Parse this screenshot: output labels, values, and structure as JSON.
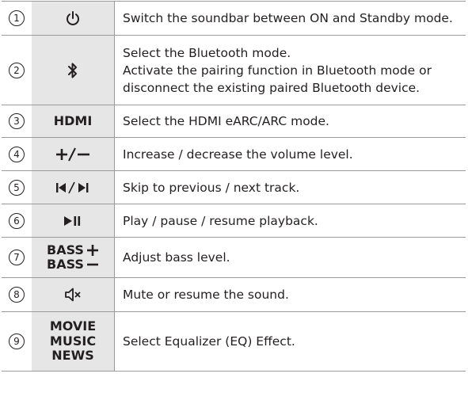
{
  "rows": [
    {
      "num": "1",
      "icon": "power-icon",
      "desc": [
        "Switch the soundbar between ON and Standby mode."
      ]
    },
    {
      "num": "2",
      "icon": "bluetooth-icon",
      "desc": [
        "Select the Bluetooth mode.",
        "Activate the pairing function in Bluetooth mode or disconnect the existing paired Bluetooth device."
      ]
    },
    {
      "num": "3",
      "key": "HDMI",
      "desc": [
        "Select the HDMI eARC/ARC mode."
      ]
    },
    {
      "num": "4",
      "icon": "plus-minus-icon",
      "desc": [
        "Increase / decrease the volume level."
      ]
    },
    {
      "num": "5",
      "icon": "prev-next-icon",
      "desc": [
        "Skip to previous / next track."
      ]
    },
    {
      "num": "6",
      "icon": "play-pause-icon",
      "desc": [
        "Play / pause / resume playback."
      ]
    },
    {
      "num": "7",
      "key_lines": [
        "BASS",
        "BASS"
      ],
      "desc": [
        "Adjust bass level."
      ]
    },
    {
      "num": "8",
      "icon": "mute-icon",
      "desc": [
        "Mute or resume the sound."
      ]
    },
    {
      "num": "9",
      "key_lines": [
        "MOVIE",
        "MUSIC",
        "NEWS"
      ],
      "desc": [
        "Select Equalizer (EQ) Effect."
      ]
    }
  ]
}
